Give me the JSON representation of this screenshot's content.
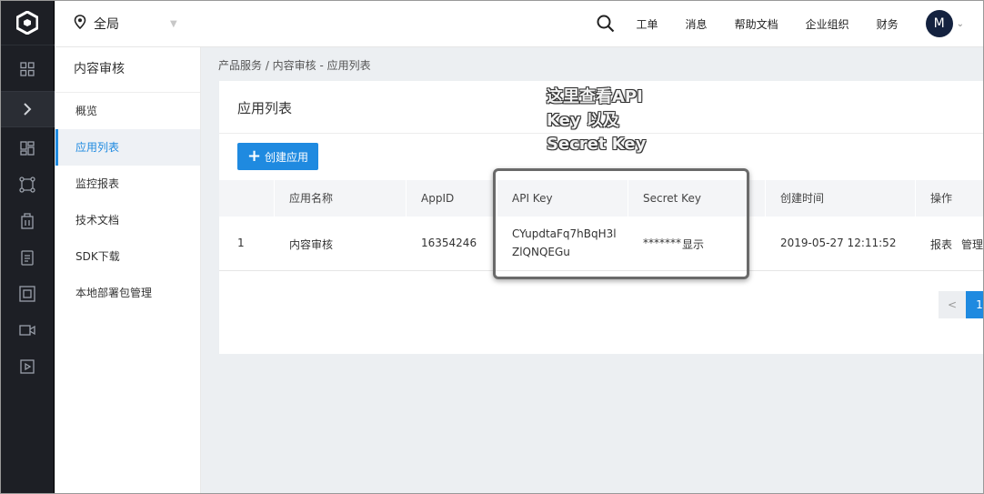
{
  "topbar": {
    "region_label": "全局",
    "nav_items": [
      "工单",
      "消息",
      "帮助文档",
      "企业组织",
      "财务"
    ],
    "avatar_initial": "M"
  },
  "rail_icons": [
    "logo-icon",
    "grid-icon",
    "chevron-right-icon",
    "dashboard-icon",
    "nodes-icon",
    "building-icon",
    "clipboard-icon",
    "frame-icon",
    "video-icon",
    "play-icon"
  ],
  "sidebar": {
    "title": "内容审核",
    "items": [
      {
        "label": "概览",
        "active": false
      },
      {
        "label": "应用列表",
        "active": true
      },
      {
        "label": "监控报表",
        "active": false
      },
      {
        "label": "技术文档",
        "active": false
      },
      {
        "label": "SDK下载",
        "active": false
      },
      {
        "label": "本地部署包管理",
        "active": false
      }
    ]
  },
  "breadcrumb": "产品服务  /  内容审核 - 应用列表",
  "main": {
    "title": "应用列表",
    "create_button": "创建应用",
    "table": {
      "headers": [
        "应用名称",
        "AppID",
        "API Key",
        "Secret Key",
        "创建时间",
        "操作"
      ],
      "rows": [
        {
          "index": "1",
          "name": "内容审核",
          "app_id": "16354246",
          "api_key_line1": "CYupdtaFq7hBqH3l",
          "api_key_line2": "ZlQNQEGu",
          "secret_masked": "*******",
          "secret_show": "显示",
          "created": "2019-05-27 12:11:52",
          "action_report": "报表",
          "action_manage": "管理"
        }
      ]
    },
    "pagination": {
      "prev": "<",
      "current": "1"
    }
  },
  "annotation": "这里查看API\nKey 以及\nSecret Key",
  "colors": {
    "accent": "#1f8ae0",
    "rail": "#1d1f25",
    "background": "#eceff2"
  }
}
